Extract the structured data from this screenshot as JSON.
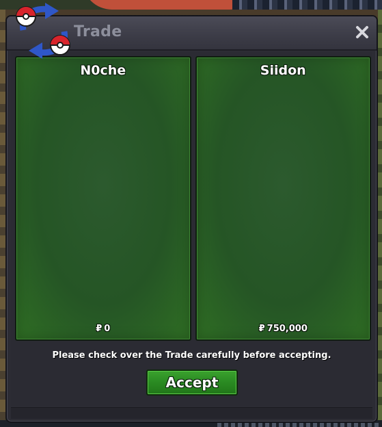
{
  "window": {
    "title": "Trade",
    "close_icon": "close-icon",
    "trade_icon": "trade-swap-icon"
  },
  "trade": {
    "left": {
      "name": "N0che",
      "currency_symbol": "₽",
      "amount": "0"
    },
    "right": {
      "name": "Siidon",
      "currency_symbol": "₽",
      "amount": "750,000"
    }
  },
  "footer": {
    "notice": "Please check over the Trade carefully before accepting.",
    "accept_label": "Accept"
  },
  "colors": {
    "panel_green": "#255525",
    "accept_green": "#2a8a22",
    "title_text": "#8d8f9c",
    "window_bg": "#2c2c34"
  }
}
